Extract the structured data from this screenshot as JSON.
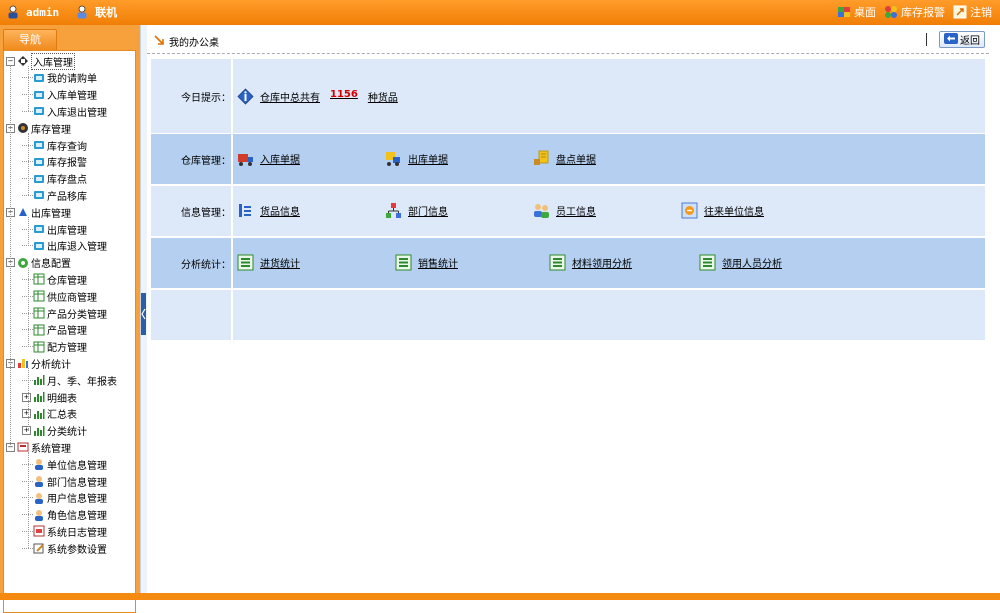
{
  "topbar": {
    "user": "admin",
    "status": "联机",
    "links": [
      {
        "label": "桌面",
        "icon": "desktop-icon"
      },
      {
        "label": "库存报警",
        "icon": "alarm-icon"
      },
      {
        "label": "注销",
        "icon": "logout-icon"
      }
    ]
  },
  "nav": {
    "tab": "导航",
    "tree": [
      {
        "label": "入库管理",
        "level": 0,
        "icon": "inbound-icon",
        "expander": "-"
      },
      {
        "label": "我的请购单",
        "level": 1,
        "icon": "doc-icon"
      },
      {
        "label": "入库单管理",
        "level": 1,
        "icon": "doc-icon"
      },
      {
        "label": "入库退出管理",
        "level": 1,
        "icon": "doc-icon"
      },
      {
        "label": "库存管理",
        "level": 0,
        "icon": "stock-icon",
        "expander": "-"
      },
      {
        "label": "库存查询",
        "level": 1,
        "icon": "doc-icon"
      },
      {
        "label": "库存报警",
        "level": 1,
        "icon": "doc-icon"
      },
      {
        "label": "库存盘点",
        "level": 1,
        "icon": "doc-icon"
      },
      {
        "label": "产品移库",
        "level": 1,
        "icon": "doc-icon"
      },
      {
        "label": "出库管理",
        "level": 0,
        "icon": "outbound-icon",
        "expander": "-"
      },
      {
        "label": "出库管理",
        "level": 1,
        "icon": "doc-icon"
      },
      {
        "label": "出库退入管理",
        "level": 1,
        "icon": "doc-icon"
      },
      {
        "label": "信息配置",
        "level": 0,
        "icon": "config-icon",
        "expander": "-"
      },
      {
        "label": "仓库管理",
        "level": 1,
        "icon": "table-icon"
      },
      {
        "label": "供应商管理",
        "level": 1,
        "icon": "table-icon"
      },
      {
        "label": "产品分类管理",
        "level": 1,
        "icon": "table-icon"
      },
      {
        "label": "产品管理",
        "level": 1,
        "icon": "table-icon"
      },
      {
        "label": "配方管理",
        "level": 1,
        "icon": "table-icon"
      },
      {
        "label": "分析统计",
        "level": 0,
        "icon": "chart-icon",
        "expander": "-"
      },
      {
        "label": "月、季、年报表",
        "level": 1,
        "icon": "bar-icon"
      },
      {
        "label": "明细表",
        "level": 1,
        "icon": "bar-icon",
        "expander": "+"
      },
      {
        "label": "汇总表",
        "level": 1,
        "icon": "bar-icon",
        "expander": "+"
      },
      {
        "label": "分类统计",
        "level": 1,
        "icon": "bar-icon",
        "expander": "+"
      },
      {
        "label": "系统管理",
        "level": 0,
        "icon": "system-icon",
        "expander": "-"
      },
      {
        "label": "单位信息管理",
        "level": 1,
        "icon": "users-icon"
      },
      {
        "label": "部门信息管理",
        "level": 1,
        "icon": "users-icon"
      },
      {
        "label": "用户信息管理",
        "level": 1,
        "icon": "users-icon"
      },
      {
        "label": "角色信息管理",
        "level": 1,
        "icon": "users-icon"
      },
      {
        "label": "系统日志管理",
        "level": 1,
        "icon": "log-icon"
      },
      {
        "label": "系统参数设置",
        "level": 1,
        "icon": "settings-icon"
      }
    ]
  },
  "main": {
    "title": "我的办公桌",
    "back": "返回",
    "tip_label": "今日提示：",
    "tip_prefix": "仓库中总共有",
    "tip_count": "1156",
    "tip_suffix": "种货品",
    "sections": [
      {
        "label": "仓库管理：",
        "items": [
          {
            "label": "入库单据",
            "icon": "truck-icon"
          },
          {
            "label": "出库单据",
            "icon": "forklift-icon"
          },
          {
            "label": "盘点单据",
            "icon": "inventory-icon"
          }
        ]
      },
      {
        "label": "信息管理：",
        "items": [
          {
            "label": "货品信息",
            "icon": "goods-icon"
          },
          {
            "label": "部门信息",
            "icon": "org-icon"
          },
          {
            "label": "员工信息",
            "icon": "staff-icon"
          },
          {
            "label": "往来单位信息",
            "icon": "partner-icon"
          }
        ]
      },
      {
        "label": "分析统计：",
        "items": [
          {
            "label": "进货统计",
            "icon": "list-icon"
          },
          {
            "label": "销售统计",
            "icon": "list-icon"
          },
          {
            "label": "材料领用分析",
            "icon": "list-icon"
          },
          {
            "label": "领用人员分析",
            "icon": "list-icon"
          }
        ]
      }
    ]
  },
  "colors": {
    "accent": "#f08a1c",
    "section_light": "#dde8f8",
    "section_dark": "#b4cff0",
    "link_blue": "#1a1a6e"
  }
}
